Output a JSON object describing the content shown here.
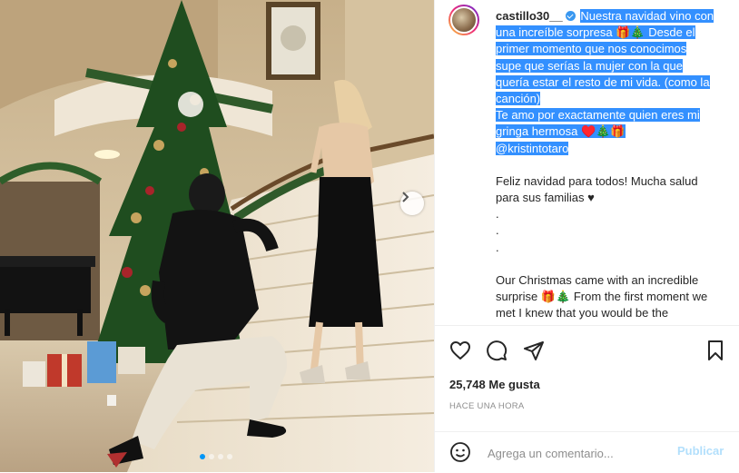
{
  "post": {
    "username": "castillo30__",
    "caption_highlighted": [
      "Nuestra navidad vino con",
      "una increíble sorpresa 🎁🎄 Desde el",
      "primer momento que nos conocimos",
      "supe que serías la mujer con la que",
      "quería estar el resto de mi vida. (como la",
      "canción)",
      "Te amo por exactamente quien eres mi",
      "gringa hermosa ♥️🎄🎁",
      "@kristintotaro"
    ],
    "caption_plain": [
      "Feliz navidad para todos! Mucha salud",
      "para sus familias ♥",
      ".",
      ".",
      "."
    ],
    "caption_english": [
      "Our Christmas came with an incredible",
      "surprise 🎁🎄 From the first moment we",
      "met I knew that you would be the"
    ],
    "likes": "25,748 Me gusta",
    "time_ago": "HACE UNA HORA"
  },
  "comment": {
    "placeholder": "Agrega un comentario...",
    "publish_label": "Publicar"
  },
  "carousel": {
    "dots": 4,
    "active_index": 0
  },
  "icons": {
    "like": "heart-icon",
    "comment": "comment-bubble-icon",
    "share": "paper-plane-icon",
    "save": "bookmark-icon",
    "emoji": "smiley-icon",
    "next": "chevron-right-icon"
  },
  "colors": {
    "highlight": "#3390ff",
    "verified": "#3897f0",
    "publish_disabled": "#b2dffc",
    "active_dot": "#0095f6"
  }
}
